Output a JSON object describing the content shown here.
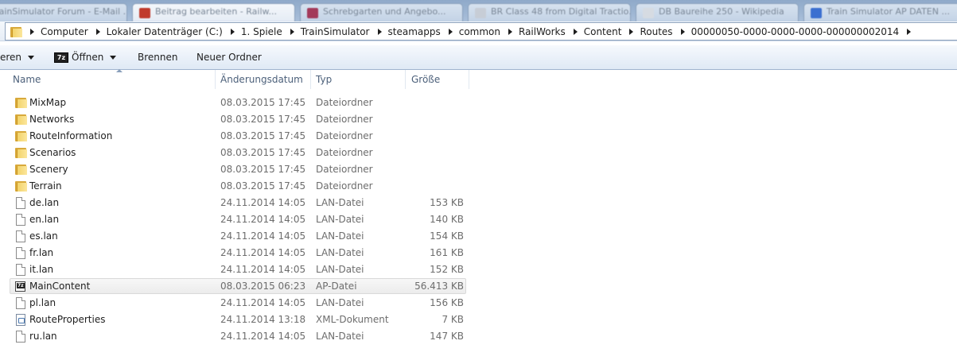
{
  "browser_tabs": [
    {
      "label": "TrainSimulator Forum - E-Mail ...",
      "active": false
    },
    {
      "label": "Beitrag bearbeiten - Railw...",
      "active": true
    },
    {
      "label": "Schrebgarten und Angebo...",
      "active": false
    },
    {
      "label": "BR Class 48 from Digital Tractio...",
      "active": false
    },
    {
      "label": "DB Baureihe 250 - Wikipedia",
      "active": false
    },
    {
      "label": "Train Simulator AP DATEN ...",
      "active": false
    }
  ],
  "address": {
    "crumbs": [
      "Computer",
      "Lokaler Datenträger (C:)",
      "1. Spiele",
      "TrainSimulator",
      "steamapps",
      "common",
      "RailWorks",
      "Content",
      "Routes",
      "00000050-0000-0000-0000-000000002014"
    ]
  },
  "toolbar": {
    "organize_label": "eren",
    "open_label": "Öffnen",
    "burn_label": "Brennen",
    "new_folder_label": "Neuer Ordner"
  },
  "columns": {
    "name": "Name",
    "date": "Änderungsdatum",
    "type": "Typ",
    "size": "Größe"
  },
  "files": [
    {
      "icon": "folder-icon",
      "name": "MixMap",
      "date": "08.03.2015 17:45",
      "type": "Dateiordner",
      "size": ""
    },
    {
      "icon": "folder-icon",
      "name": "Networks",
      "date": "08.03.2015 17:45",
      "type": "Dateiordner",
      "size": ""
    },
    {
      "icon": "folder-icon",
      "name": "RouteInformation",
      "date": "08.03.2015 17:45",
      "type": "Dateiordner",
      "size": ""
    },
    {
      "icon": "folder-icon",
      "name": "Scenarios",
      "date": "08.03.2015 17:45",
      "type": "Dateiordner",
      "size": ""
    },
    {
      "icon": "folder-icon",
      "name": "Scenery",
      "date": "08.03.2015 17:45",
      "type": "Dateiordner",
      "size": ""
    },
    {
      "icon": "folder-icon",
      "name": "Terrain",
      "date": "08.03.2015 17:45",
      "type": "Dateiordner",
      "size": ""
    },
    {
      "icon": "file-icon",
      "name": "de.lan",
      "date": "24.11.2014 14:05",
      "type": "LAN-Datei",
      "size": "153 KB"
    },
    {
      "icon": "file-icon",
      "name": "en.lan",
      "date": "24.11.2014 14:05",
      "type": "LAN-Datei",
      "size": "140 KB"
    },
    {
      "icon": "file-icon",
      "name": "es.lan",
      "date": "24.11.2014 14:05",
      "type": "LAN-Datei",
      "size": "154 KB"
    },
    {
      "icon": "file-icon",
      "name": "fr.lan",
      "date": "24.11.2014 14:05",
      "type": "LAN-Datei",
      "size": "161 KB"
    },
    {
      "icon": "file-icon",
      "name": "it.lan",
      "date": "24.11.2014 14:05",
      "type": "LAN-Datei",
      "size": "152 KB"
    },
    {
      "icon": "archive-7z-icon",
      "name": "MainContent",
      "date": "08.03.2015 06:23",
      "type": "AP-Datei",
      "size": "56.413 KB",
      "selected": true
    },
    {
      "icon": "file-icon",
      "name": "pl.lan",
      "date": "24.11.2014 14:05",
      "type": "LAN-Datei",
      "size": "156 KB"
    },
    {
      "icon": "xml-document-icon",
      "name": "RouteProperties",
      "date": "24.11.2014 13:18",
      "type": "XML-Dokument",
      "size": "7 KB"
    },
    {
      "icon": "file-icon",
      "name": "ru.lan",
      "date": "24.11.2014 14:05",
      "type": "LAN-Datei",
      "size": "147 KB"
    }
  ]
}
